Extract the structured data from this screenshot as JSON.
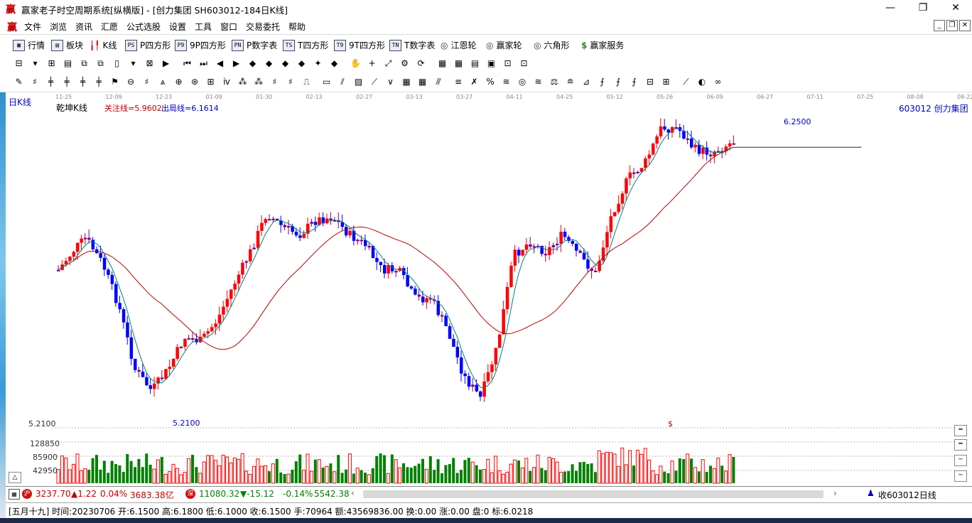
{
  "window": {
    "title": "赢家老子时空周期系统[纵横版] - [创力集团  SH603012-184日K线]",
    "logo_glyph": "赢",
    "minimize": "—",
    "restore": "❐",
    "close": "✕"
  },
  "menu": {
    "items": [
      "文件",
      "浏览",
      "资讯",
      "汇愿",
      "公式选股",
      "设置",
      "工具",
      "窗口",
      "交易委托",
      "帮助"
    ]
  },
  "toolbar1": {
    "items": [
      {
        "label": "行情",
        "icon": "grid-icon"
      },
      {
        "label": "板块",
        "icon": "blocks-icon"
      },
      {
        "label": "K线",
        "icon": "candlestick-icon"
      },
      {
        "label": "P四方形",
        "icon": "ps-icon",
        "badge": "PS"
      },
      {
        "label": "9P四方形",
        "icon": "p9-icon",
        "badge": "P9"
      },
      {
        "label": "P数字表",
        "icon": "pn-icon",
        "badge": "PN"
      },
      {
        "label": "T四方形",
        "icon": "ts-icon",
        "badge": "TS"
      },
      {
        "label": "9T四方形",
        "icon": "t9-icon",
        "badge": "T9"
      },
      {
        "label": "T数字表",
        "icon": "tn-icon",
        "badge": "TN"
      },
      {
        "label": "江恩轮",
        "icon": "gann-wheel-icon"
      },
      {
        "label": "赢家轮",
        "icon": "winner-wheel-icon"
      },
      {
        "label": "六角形",
        "icon": "hexagon-icon"
      },
      {
        "label": "赢家服务",
        "icon": "dollar-icon"
      }
    ]
  },
  "chart": {
    "period_label": "日K线",
    "indicator_name": "乾坤K线",
    "focus_line": "关注线=5.9602",
    "exit_line": "出局线=6.1614",
    "stock_label": "603012  创力集团",
    "high_label": "6.2500",
    "low_label": "5.2100",
    "dollar_marker": "$",
    "date_ticks": [
      "11-25",
      "12-09",
      "12-23",
      "01-09",
      "01-30",
      "02-13",
      "02-27",
      "03-13",
      "03-27",
      "04-11",
      "04-25",
      "05-12",
      "05-26",
      "06-09",
      "06-27",
      "07-11",
      "07-25",
      "08-08",
      "08-22"
    ],
    "price_axis_label": "5.2100",
    "volume_ticks": [
      "128850",
      "85900",
      "42950"
    ],
    "colors": {
      "up": "#ff0000",
      "down": "#0000ff",
      "neutral": "#800080",
      "fast_ma": "#008080",
      "slow_ma": "#c00000",
      "vol_up": "#ff0000",
      "vol_down": "#008000"
    }
  },
  "statusbar": {
    "sh_index": "3237.70",
    "sh_change": "▲1.22",
    "sh_pct": "0.04%",
    "sh_amount": "3683.38亿",
    "sz_index": "11080.32",
    "sz_change": "▼-15.12",
    "sz_pct": "-0.14%",
    "sz_amount": "5542.38",
    "right_label": "收603012日线"
  },
  "infobar": {
    "text": "[五月十九] 时间:20230706 开:6.1500 高:6.1800 低:6.1000 收:6.1500 手:70964 额:43569836.00 换:0.00 涨:0.00 盘:0 标:6.0218"
  }
}
